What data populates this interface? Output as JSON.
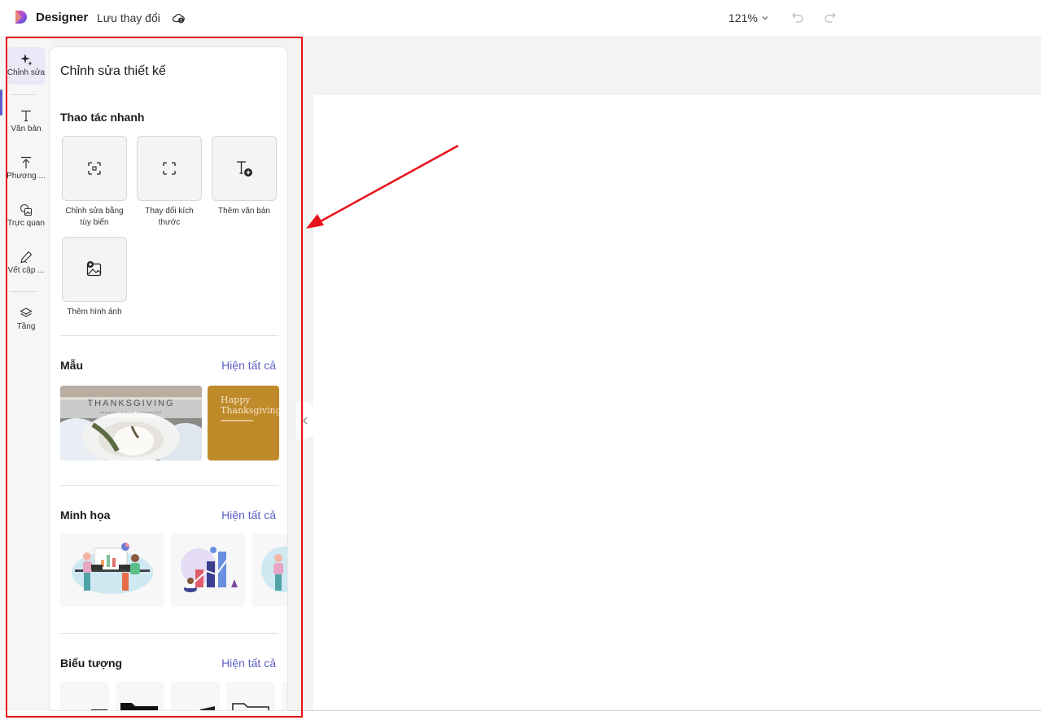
{
  "app": {
    "name": "Designer",
    "save_status": "Lưu thay đổi",
    "zoom": "121%"
  },
  "colors": {
    "accent": "#5b5fc7",
    "annotation": "#e8121b"
  },
  "rail": {
    "items": [
      {
        "label": "Chỉnh sửa",
        "icon": "sparkle-icon"
      },
      {
        "label": "Văn bản",
        "icon": "text-icon"
      },
      {
        "label": "Phương ...",
        "icon": "upload-icon"
      },
      {
        "label": "Trực quan",
        "icon": "visuals-icon"
      },
      {
        "label": "Vết cập ...",
        "icon": "pen-icon"
      },
      {
        "label": "Tầng",
        "icon": "layers-icon"
      }
    ]
  },
  "panel": {
    "title": "Chỉnh sửa thiết kế",
    "quick_actions": {
      "title": "Thao tác nhanh",
      "items": [
        {
          "label_line1": "Chỉnh sửa bằng",
          "label_line2": "tùy biến",
          "icon": "crop-icon"
        },
        {
          "label_line1": "Thay đổi kích",
          "label_line2": "thước",
          "icon": "resize-icon"
        },
        {
          "label_line1": "Thêm văn bản",
          "label_line2": "",
          "icon": "add-text-icon"
        },
        {
          "label_line1": "Thêm hình ảnh",
          "label_line2": "",
          "icon": "add-image-icon"
        }
      ]
    },
    "templates": {
      "title": "Mẫu",
      "see_all": "Hiện tất cả",
      "items": [
        {
          "heading": "THANKSGIVING",
          "sub": "REFLECT | HONOR | APPRECIATE"
        },
        {
          "heading_line1": "Happy",
          "heading_line2": "Thanksgiving"
        }
      ]
    },
    "illustrations": {
      "title": "Minh họa",
      "see_all": "Hiện tất cả"
    },
    "icons": {
      "title": "Biểu tượng",
      "see_all": "Hiện tất cả"
    }
  }
}
